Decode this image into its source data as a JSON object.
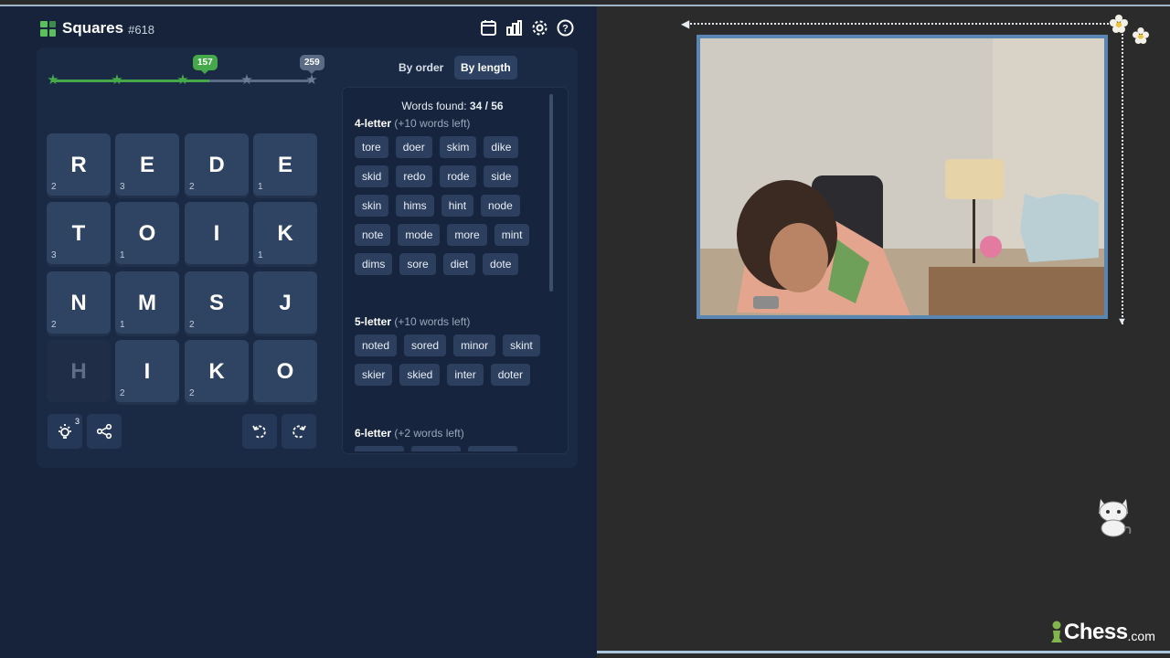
{
  "header": {
    "title": "Squares",
    "puzzle_number": "#618",
    "icons": [
      "calendar-icon",
      "stats-icon",
      "settings-icon",
      "help-icon"
    ]
  },
  "progress": {
    "current_score": "157",
    "max_score": "259",
    "current_fraction": 0.606
  },
  "board": {
    "tiles": [
      {
        "letter": "R",
        "count": "2",
        "used": false
      },
      {
        "letter": "E",
        "count": "3",
        "used": false
      },
      {
        "letter": "D",
        "count": "2",
        "used": false
      },
      {
        "letter": "E",
        "count": "1",
        "used": false
      },
      {
        "letter": "T",
        "count": "3",
        "used": false
      },
      {
        "letter": "O",
        "count": "1",
        "used": false
      },
      {
        "letter": "I",
        "count": "",
        "used": false
      },
      {
        "letter": "K",
        "count": "1",
        "used": false
      },
      {
        "letter": "N",
        "count": "2",
        "used": false
      },
      {
        "letter": "M",
        "count": "1",
        "used": false
      },
      {
        "letter": "S",
        "count": "2",
        "used": false
      },
      {
        "letter": "J",
        "count": "",
        "used": false
      },
      {
        "letter": "H",
        "count": "",
        "used": true
      },
      {
        "letter": "I",
        "count": "2",
        "used": false
      },
      {
        "letter": "K",
        "count": "2",
        "used": false
      },
      {
        "letter": "O",
        "count": "",
        "used": false
      }
    ]
  },
  "tools": {
    "hint_count": "3",
    "buttons": [
      "hint-icon",
      "share-icon",
      "rotate-left-icon",
      "rotate-right-icon"
    ]
  },
  "sort": {
    "by_order": "By order",
    "by_length": "By length",
    "selected": "By length"
  },
  "words": {
    "found_label": "Words found:",
    "found_count": "34 / 56",
    "sections": [
      {
        "title": "4-letter",
        "remaining": "(+10 words left)",
        "words": [
          "tore",
          "doer",
          "skim",
          "dike",
          "skid",
          "redo",
          "rode",
          "side",
          "skin",
          "hims",
          "hint",
          "node",
          "note",
          "mode",
          "more",
          "mint",
          "dims",
          "sore",
          "diet",
          "dote"
        ]
      },
      {
        "title": "5-letter",
        "remaining": "(+10 words left)",
        "words": [
          "noted",
          "sored",
          "minor",
          "skint",
          "skier",
          "skied",
          "inter",
          "doter"
        ]
      },
      {
        "title": "6-letter",
        "remaining": "(+2 words left)",
        "words": []
      }
    ]
  },
  "overlay": {
    "brand_name": "Chess",
    "brand_tld": ".com",
    "colors": {
      "frame": "#5a86b4",
      "accent_green": "#45a84a"
    }
  }
}
